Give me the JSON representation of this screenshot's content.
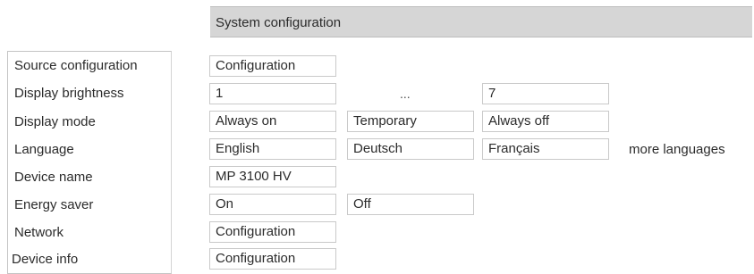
{
  "header": {
    "title": "System configuration"
  },
  "rows": [
    {
      "label": "Source configuration",
      "options": [
        "Configuration"
      ]
    },
    {
      "label": "Display brightness",
      "options": [
        "1",
        "7"
      ],
      "separator": "..."
    },
    {
      "label": "Display mode",
      "options": [
        "Always on",
        "Temporary",
        "Always off"
      ]
    },
    {
      "label": "Language",
      "options": [
        "English",
        "Deutsch",
        "Français"
      ],
      "more": "more languages"
    },
    {
      "label": "Device name",
      "options": [
        "MP 3100 HV"
      ]
    },
    {
      "label": "Energy saver",
      "options": [
        "On",
        "Off"
      ]
    },
    {
      "label": "Network",
      "options": [
        "Configuration"
      ]
    },
    {
      "label": "Device info",
      "options": [
        "Configuration"
      ]
    }
  ]
}
